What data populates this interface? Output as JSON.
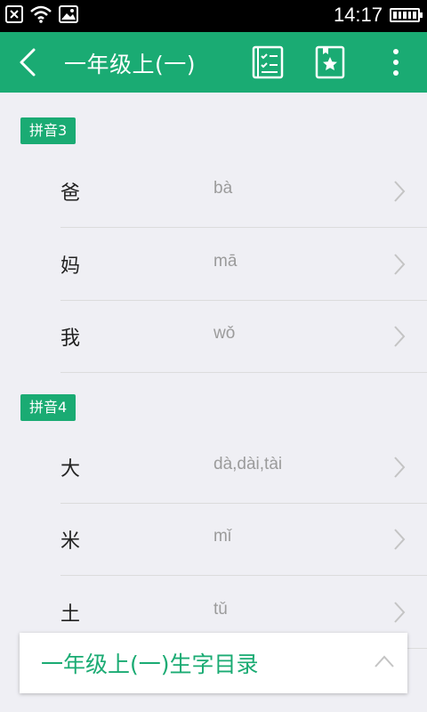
{
  "status_bar": {
    "time": "14:17",
    "icons": [
      "close-box-icon",
      "wifi-icon",
      "image-icon",
      "battery-icon"
    ]
  },
  "app_bar": {
    "title": "一年级上(一)",
    "icons": [
      "back-icon",
      "checklist-icon",
      "star-book-icon",
      "more-vert-icon"
    ]
  },
  "sections": [
    {
      "label": "拼音3",
      "items": [
        {
          "char": "爸",
          "pinyin": "bà"
        },
        {
          "char": "妈",
          "pinyin": "mā"
        },
        {
          "char": "我",
          "pinyin": "wǒ"
        }
      ]
    },
    {
      "label": "拼音4",
      "items": [
        {
          "char": "大",
          "pinyin": "dà,dài,tài"
        },
        {
          "char": "米",
          "pinyin": "mǐ"
        },
        {
          "char": "土",
          "pinyin": "tǔ"
        }
      ]
    }
  ],
  "bottom_panel": {
    "title": "一年级上(一)生字目录"
  },
  "colors": {
    "accent": "#1aab73",
    "background": "#efeff4",
    "pinyin": "#9b9b9b"
  }
}
